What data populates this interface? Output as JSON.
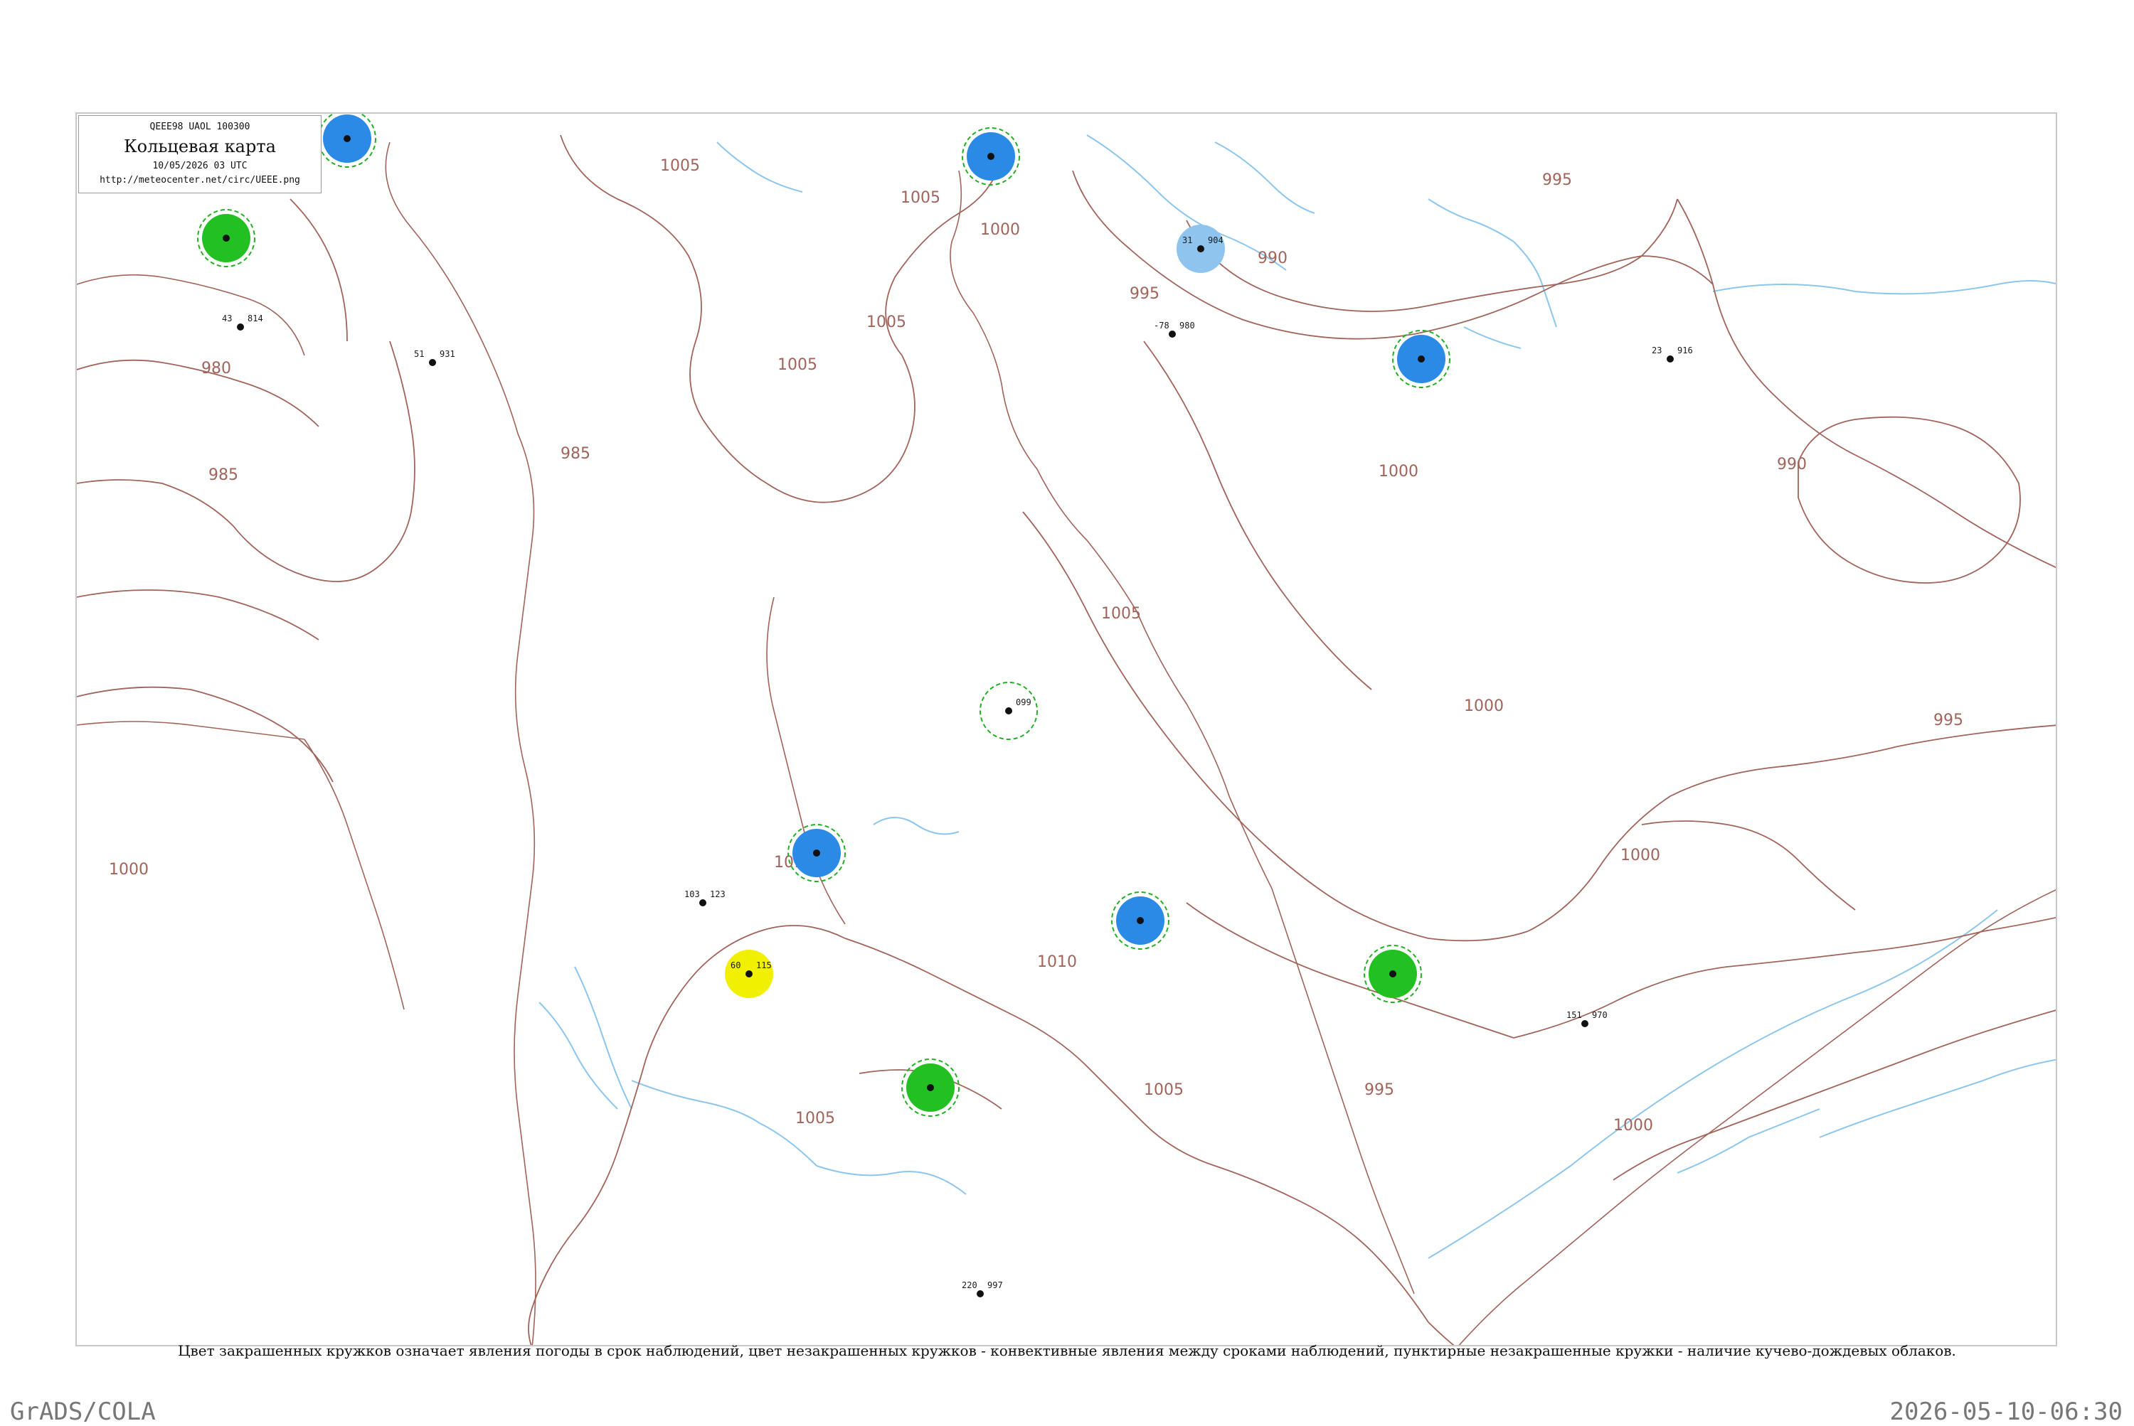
{
  "header": {
    "code_line": "QEEE98  UAOL  100300",
    "title": "Кольцевая карта",
    "datetime": "10/05/2026 03 UTC",
    "url": "http://meteocenter.net/circ/UEEE.png"
  },
  "legend_note": "Цвет закрашенных кружков означает явления погоды в срок наблюдений, цвет незакрашенных кружков - конвективные явления между сроками наблюдений, пунктирные незакрашенные кружки - наличие кучево-дождевых облаков.",
  "footer": {
    "left": "GrADS/COLA",
    "right": "2026-05-10-06:30"
  },
  "colors": {
    "isobar": "#a0645a",
    "river": "#8cc6ec",
    "rain_fill": "#22c022",
    "snow_fill": "#2a8ae6",
    "fog_fill": "#8ec4ee",
    "haze_fill": "#f0f000",
    "cb_ring": "#22b022",
    "station_text": "#1a1a1a",
    "station_name": "#8a8a8a"
  },
  "isobar_labels": [
    "1005",
    "1005",
    "1005",
    "1005",
    "1000",
    "995",
    "995",
    "990",
    "1000",
    "990",
    "995",
    "1000",
    "1000",
    "1005",
    "1010",
    "1010",
    "1005",
    "1005",
    "995",
    "1000",
    "985",
    "980",
    "985",
    "1000"
  ],
  "stations": [
    {
      "id": "s1",
      "cat": "snow",
      "ring": "dash",
      "pres": "",
      "temp": "",
      "name": ""
    },
    {
      "id": "s2",
      "cat": "rain",
      "ring": "dash",
      "pres": "",
      "temp": "",
      "name": ""
    },
    {
      "id": "s3",
      "cat": "snow",
      "ring": "dash",
      "pres": "",
      "temp": "",
      "name": ""
    },
    {
      "id": "s4",
      "cat": "rain",
      "ring": "dash",
      "pres": "",
      "temp": "",
      "name": ""
    },
    {
      "id": "s5",
      "cat": "snow",
      "ring": "dash",
      "pres": "",
      "temp": "",
      "name": ""
    },
    {
      "id": "s6",
      "cat": "fog",
      "ring": "none",
      "pres": "904",
      "temp": "31",
      "name": ""
    },
    {
      "id": "s7",
      "cat": "snow",
      "ring": "dash",
      "pres": "",
      "temp": "",
      "name": ""
    },
    {
      "id": "s8",
      "cat": "haze",
      "ring": "none",
      "pres": "115",
      "temp": "60",
      "name": ""
    },
    {
      "id": "s9",
      "cat": "snow",
      "ring": "dash",
      "pres": "",
      "temp": "",
      "name": ""
    },
    {
      "id": "s10",
      "cat": "rain",
      "ring": "dash",
      "pres": "",
      "temp": "",
      "name": ""
    },
    {
      "id": "s11",
      "cat": "none",
      "ring": "dash",
      "pres": "099",
      "temp": "",
      "name": ""
    },
    {
      "id": "s12",
      "cat": "none",
      "ring": "none",
      "pres": "814",
      "temp": "43",
      "name": ""
    },
    {
      "id": "s13",
      "cat": "none",
      "ring": "none",
      "pres": "931",
      "temp": "51",
      "name": ""
    },
    {
      "id": "s14",
      "cat": "none",
      "ring": "none",
      "pres": "980",
      "temp": "-78",
      "name": ""
    },
    {
      "id": "s15",
      "cat": "none",
      "ring": "none",
      "pres": "916",
      "temp": "23",
      "name": ""
    },
    {
      "id": "s16",
      "cat": "none",
      "ring": "none",
      "pres": "970",
      "temp": "151",
      "name": ""
    },
    {
      "id": "s17",
      "cat": "none",
      "ring": "none",
      "pres": "997",
      "temp": "220",
      "name": ""
    },
    {
      "id": "s18",
      "cat": "none",
      "ring": "none",
      "pres": "123",
      "temp": "103",
      "name": ""
    }
  ]
}
